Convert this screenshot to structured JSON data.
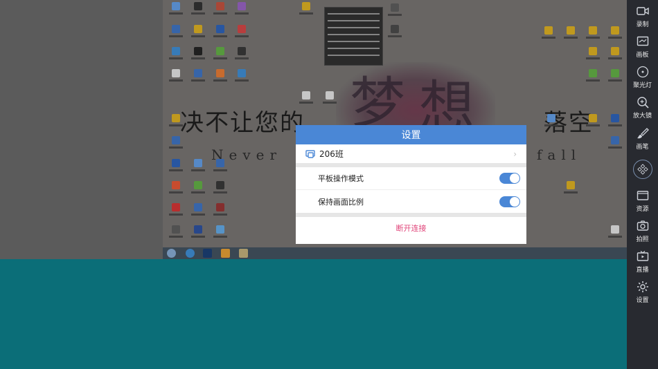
{
  "dialog": {
    "title": "设置",
    "class_name": "206班",
    "tablet_mode_label": "平板操作模式",
    "tablet_mode_on": true,
    "keep_ratio_label": "保持画面比例",
    "keep_ratio_on": true,
    "disconnect_label": "断开连接"
  },
  "wallpaper": {
    "slogan_left": "决不让您的",
    "slogan_right": "落空",
    "tag_left": "Never",
    "tag_right": "fall"
  },
  "toolbar": {
    "items": [
      {
        "label": "录制",
        "icon": "video-camera-icon"
      },
      {
        "label": "画板",
        "icon": "whiteboard-icon"
      },
      {
        "label": "聚光灯",
        "icon": "spotlight-icon"
      },
      {
        "label": "放大镜",
        "icon": "magnifier-icon"
      },
      {
        "label": "画笔",
        "icon": "brush-icon"
      },
      {
        "label": "资源",
        "icon": "folder-icon"
      },
      {
        "label": "拍照",
        "icon": "camera-icon"
      },
      {
        "label": "直播",
        "icon": "live-icon"
      },
      {
        "label": "设置",
        "icon": "gear-icon"
      }
    ]
  },
  "colors": {
    "accent": "#4a87d6",
    "danger": "#e0457a",
    "toolbar_bg": "#282a30",
    "app_bg": "#0b6e78"
  }
}
